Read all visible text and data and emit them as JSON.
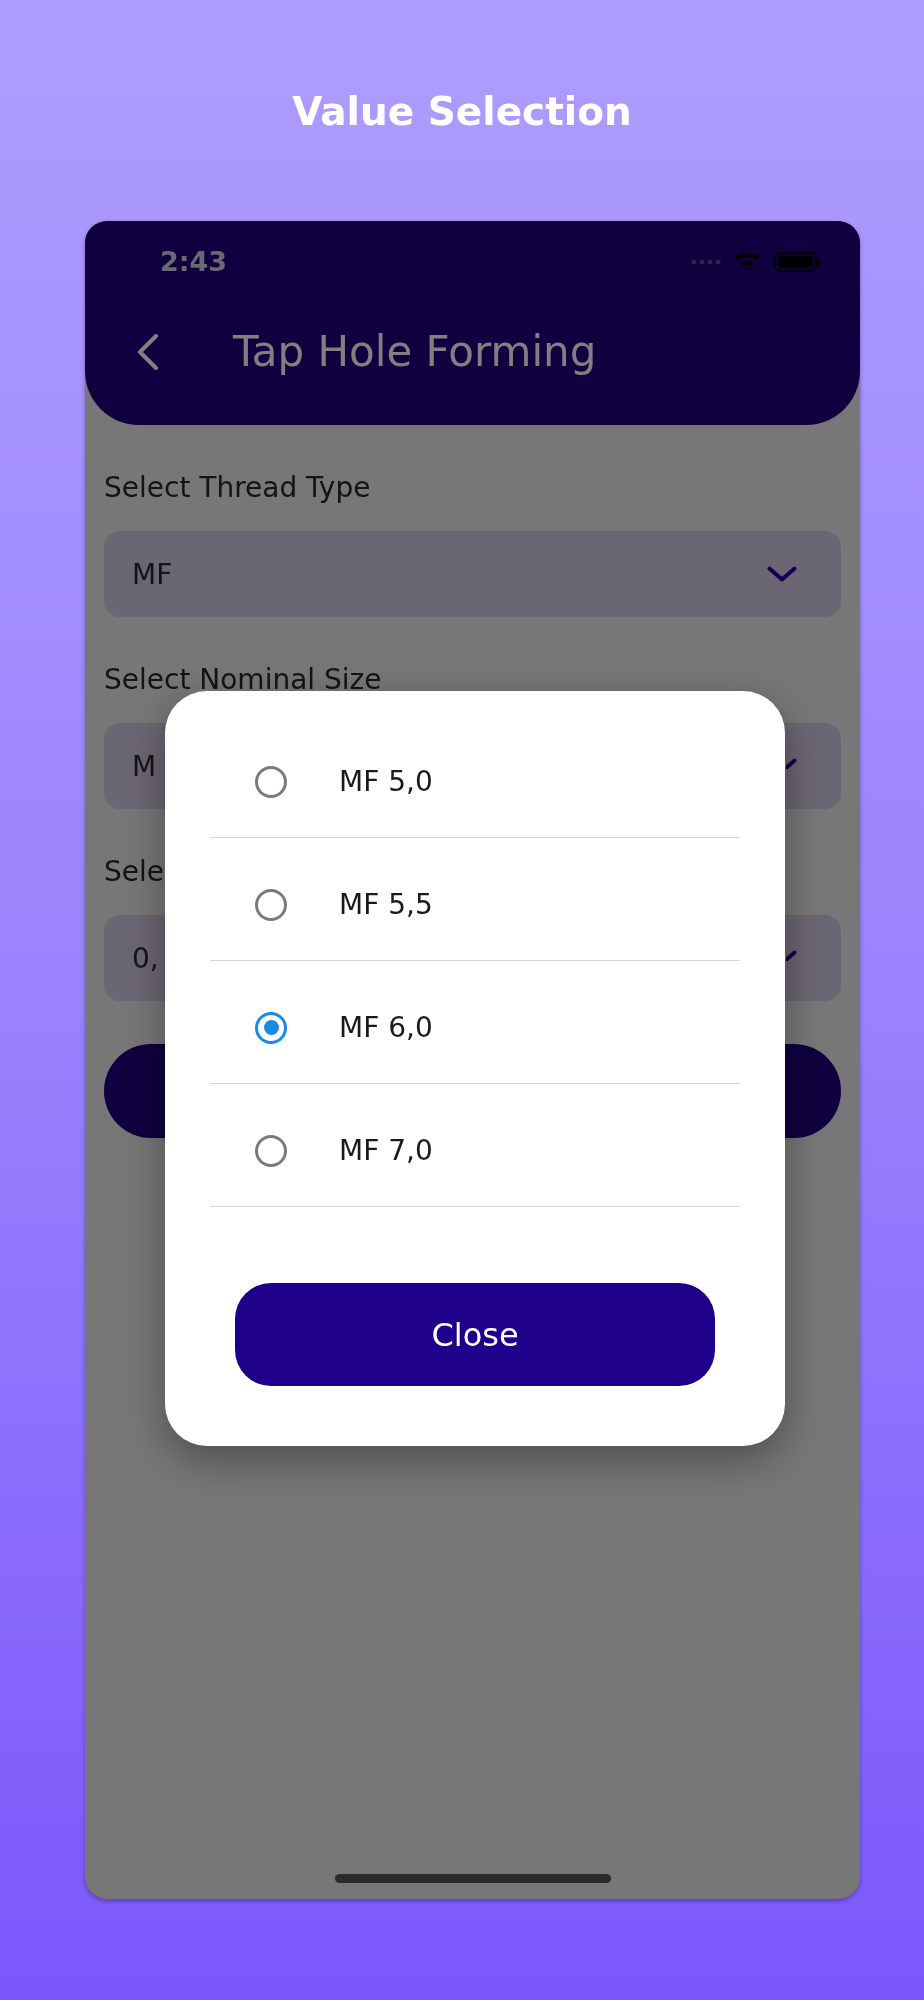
{
  "page_title": "Value Selection",
  "status_bar": {
    "time": "2:43"
  },
  "header": {
    "title": "Tap Hole Forming"
  },
  "form": {
    "fields": [
      {
        "label": "Select Thread Type",
        "value": "MF"
      },
      {
        "label": "Select Nominal Size",
        "value": "M"
      },
      {
        "label": "Sele",
        "value": "0,"
      }
    ]
  },
  "dialog": {
    "options": [
      {
        "label": "MF 5,0",
        "selected": false
      },
      {
        "label": "MF 5,5",
        "selected": false
      },
      {
        "label": "MF 6,0",
        "selected": true
      },
      {
        "label": "MF 7,0",
        "selected": false
      }
    ],
    "close_button": "Close"
  }
}
